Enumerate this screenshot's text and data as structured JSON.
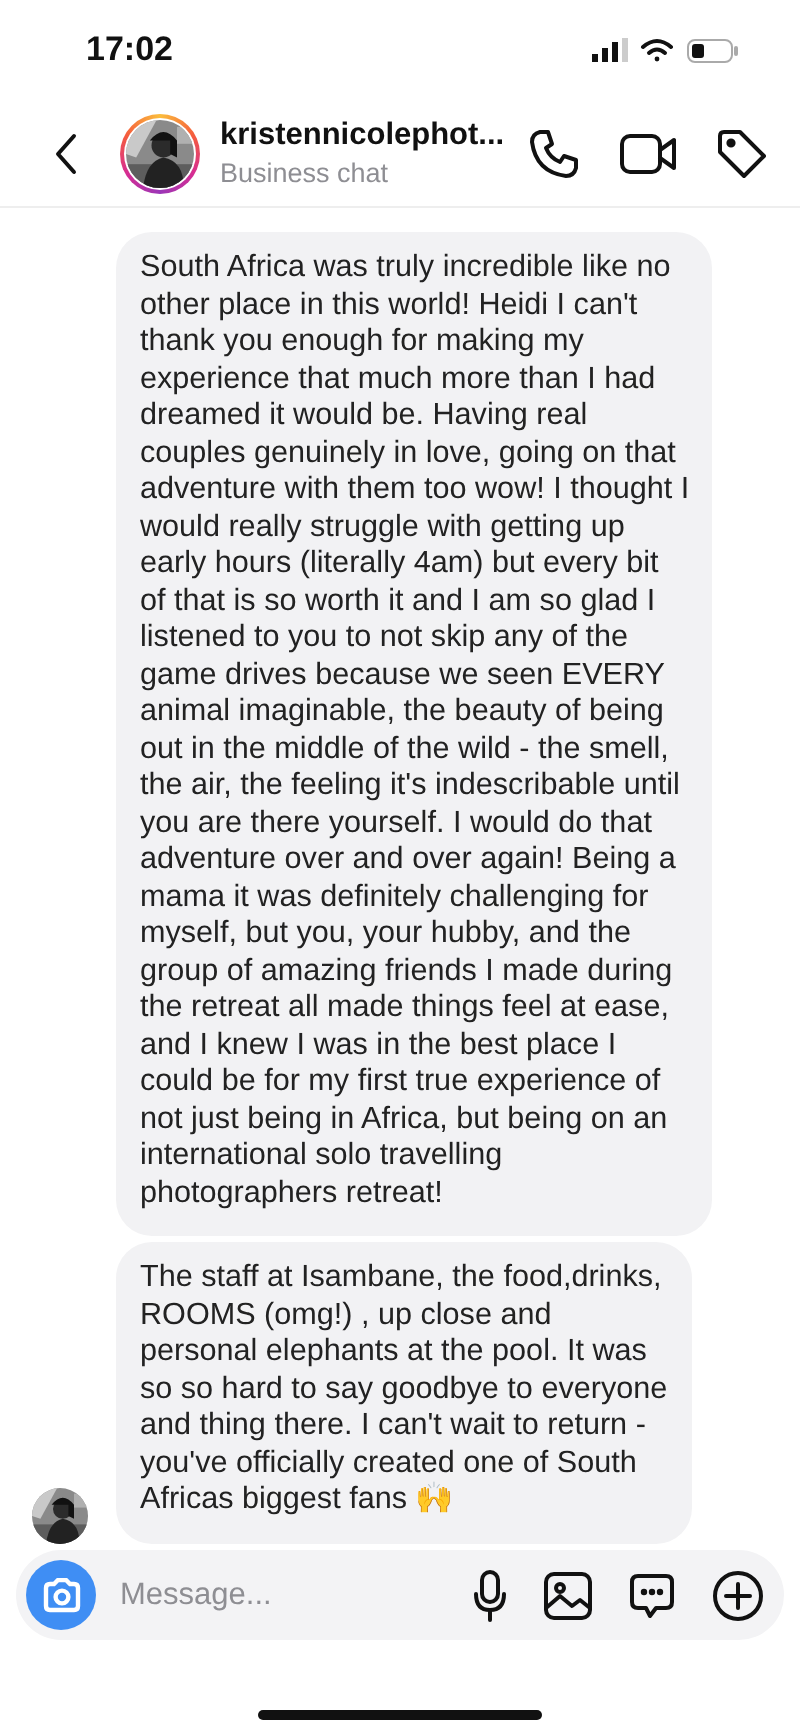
{
  "status_bar": {
    "time": "17:02"
  },
  "header": {
    "name": "kristennicolephot...",
    "subtitle": "Business chat",
    "has_story_ring": true
  },
  "messages": [
    {
      "text": "South Africa was truly incredible like no other place in this world! Heidi I can't thank you enough for making my experience that much more than I had dreamed it would be. Having real couples genuinely in love, going on that adventure with them too wow! I thought I would really struggle with getting up early hours (literally 4am) but every bit of that is so worth it and I am so glad I listened to you to not skip any of the game drives because we seen EVERY animal imaginable, the beauty of being out in the middle of the wild - the smell, the air, the feeling it's indescribable until you are there yourself. I would do that adventure over and over again! Being a mama it was definitely challenging for myself, but you, your hubby, and the group of amazing friends I made during the retreat all made things feel at ease, and I knew I was in the best place I could be for my first true experience of not just being in Africa, but being on an international solo travelling photographers retreat!",
      "show_avatar": false
    },
    {
      "text": "The staff at Isambane, the food,drinks, ROOMS (omg!) , up close and personal elephants at the pool. It was so so hard to say goodbye to everyone and thing there. I can't wait to return - you've officially created one of South Africas biggest fans 🙌",
      "show_avatar": true
    }
  ],
  "composer": {
    "placeholder": "Message..."
  }
}
